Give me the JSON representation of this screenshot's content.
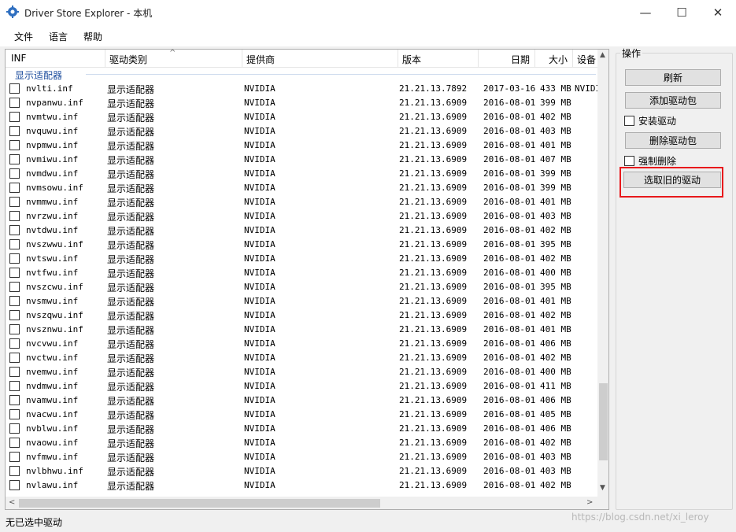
{
  "window": {
    "title": "Driver Store Explorer - 本机",
    "minimize": "—",
    "maximize": "☐",
    "close": "✕"
  },
  "menu": [
    "文件",
    "语言",
    "帮助"
  ],
  "columns": [
    "INF",
    "驱动类别",
    "提供商",
    "版本",
    "日期",
    "大小",
    "设备"
  ],
  "group": "显示适配器",
  "rows": [
    [
      "nvlti.inf",
      "显示适配器",
      "NVIDIA",
      "21.21.13.7892",
      "2017-03-16",
      "433 MB",
      "NVIDI"
    ],
    [
      "nvpanwu.inf",
      "显示适配器",
      "NVIDIA",
      "21.21.13.6909",
      "2016-08-01",
      "399 MB",
      ""
    ],
    [
      "nvmtwu.inf",
      "显示适配器",
      "NVIDIA",
      "21.21.13.6909",
      "2016-08-01",
      "402 MB",
      ""
    ],
    [
      "nvquwu.inf",
      "显示适配器",
      "NVIDIA",
      "21.21.13.6909",
      "2016-08-01",
      "403 MB",
      ""
    ],
    [
      "nvpmwu.inf",
      "显示适配器",
      "NVIDIA",
      "21.21.13.6909",
      "2016-08-01",
      "401 MB",
      ""
    ],
    [
      "nvmiwu.inf",
      "显示适配器",
      "NVIDIA",
      "21.21.13.6909",
      "2016-08-01",
      "407 MB",
      ""
    ],
    [
      "nvmdwu.inf",
      "显示适配器",
      "NVIDIA",
      "21.21.13.6909",
      "2016-08-01",
      "399 MB",
      ""
    ],
    [
      "nvmsowu.inf",
      "显示适配器",
      "NVIDIA",
      "21.21.13.6909",
      "2016-08-01",
      "399 MB",
      ""
    ],
    [
      "nvmmwu.inf",
      "显示适配器",
      "NVIDIA",
      "21.21.13.6909",
      "2016-08-01",
      "401 MB",
      ""
    ],
    [
      "nvrzwu.inf",
      "显示适配器",
      "NVIDIA",
      "21.21.13.6909",
      "2016-08-01",
      "403 MB",
      ""
    ],
    [
      "nvtdwu.inf",
      "显示适配器",
      "NVIDIA",
      "21.21.13.6909",
      "2016-08-01",
      "402 MB",
      ""
    ],
    [
      "nvszwwu.inf",
      "显示适配器",
      "NVIDIA",
      "21.21.13.6909",
      "2016-08-01",
      "395 MB",
      ""
    ],
    [
      "nvtswu.inf",
      "显示适配器",
      "NVIDIA",
      "21.21.13.6909",
      "2016-08-01",
      "402 MB",
      ""
    ],
    [
      "nvtfwu.inf",
      "显示适配器",
      "NVIDIA",
      "21.21.13.6909",
      "2016-08-01",
      "400 MB",
      ""
    ],
    [
      "nvszcwu.inf",
      "显示适配器",
      "NVIDIA",
      "21.21.13.6909",
      "2016-08-01",
      "395 MB",
      ""
    ],
    [
      "nvsmwu.inf",
      "显示适配器",
      "NVIDIA",
      "21.21.13.6909",
      "2016-08-01",
      "401 MB",
      ""
    ],
    [
      "nvszqwu.inf",
      "显示适配器",
      "NVIDIA",
      "21.21.13.6909",
      "2016-08-01",
      "402 MB",
      ""
    ],
    [
      "nvsznwu.inf",
      "显示适配器",
      "NVIDIA",
      "21.21.13.6909",
      "2016-08-01",
      "401 MB",
      ""
    ],
    [
      "nvcvwu.inf",
      "显示适配器",
      "NVIDIA",
      "21.21.13.6909",
      "2016-08-01",
      "406 MB",
      ""
    ],
    [
      "nvctwu.inf",
      "显示适配器",
      "NVIDIA",
      "21.21.13.6909",
      "2016-08-01",
      "402 MB",
      ""
    ],
    [
      "nvemwu.inf",
      "显示适配器",
      "NVIDIA",
      "21.21.13.6909",
      "2016-08-01",
      "400 MB",
      ""
    ],
    [
      "nvdmwu.inf",
      "显示适配器",
      "NVIDIA",
      "21.21.13.6909",
      "2016-08-01",
      "411 MB",
      ""
    ],
    [
      "nvamwu.inf",
      "显示适配器",
      "NVIDIA",
      "21.21.13.6909",
      "2016-08-01",
      "406 MB",
      ""
    ],
    [
      "nvacwu.inf",
      "显示适配器",
      "NVIDIA",
      "21.21.13.6909",
      "2016-08-01",
      "405 MB",
      ""
    ],
    [
      "nvblwu.inf",
      "显示适配器",
      "NVIDIA",
      "21.21.13.6909",
      "2016-08-01",
      "406 MB",
      ""
    ],
    [
      "nvaowu.inf",
      "显示适配器",
      "NVIDIA",
      "21.21.13.6909",
      "2016-08-01",
      "402 MB",
      ""
    ],
    [
      "nvfmwu.inf",
      "显示适配器",
      "NVIDIA",
      "21.21.13.6909",
      "2016-08-01",
      "403 MB",
      ""
    ],
    [
      "nvlbhwu.inf",
      "显示适配器",
      "NVIDIA",
      "21.21.13.6909",
      "2016-08-01",
      "403 MB",
      ""
    ],
    [
      "nvlawu.inf",
      "显示适配器",
      "NVIDIA",
      "21.21.13.6909",
      "2016-08-01",
      "402 MB",
      ""
    ]
  ],
  "operations": {
    "title": "操作",
    "refresh": "刷新",
    "add_package": "添加驱动包",
    "install_driver": "安装驱动",
    "delete_package": "删除驱动包",
    "force_delete": "强制删除",
    "select_old": "选取旧的驱动"
  },
  "status": "无已选中驱动",
  "watermark": "https://blog.csdn.net/xi_leroy",
  "highlight_color": "#e8191c"
}
